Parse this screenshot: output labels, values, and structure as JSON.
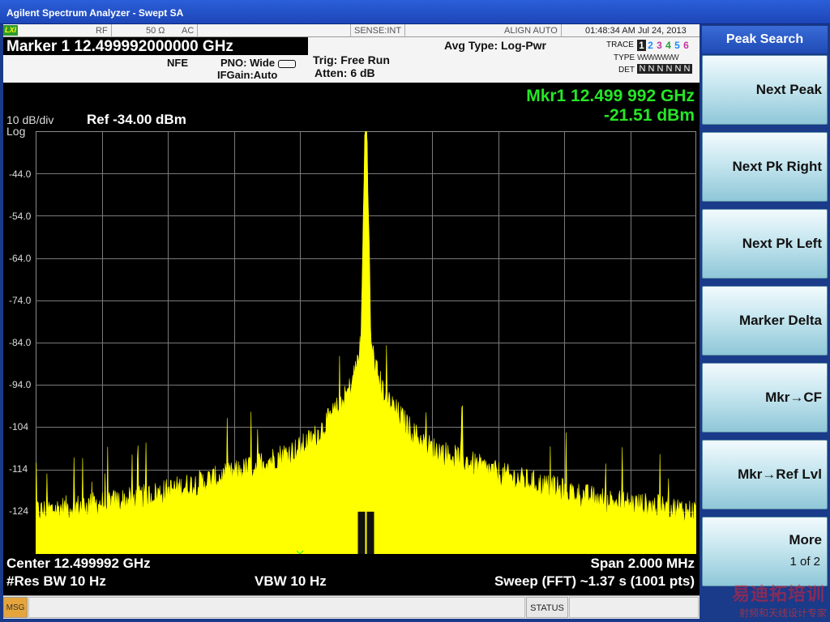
{
  "window": {
    "title": "Agilent Spectrum Analyzer - Swept SA"
  },
  "status": {
    "lxi": "LXI",
    "rf": "RF",
    "impedance": "50 Ω",
    "coupling": "AC",
    "sense": "SENSE:INT",
    "align": "ALIGN AUTO",
    "datetime": "01:48:34 AM Jul 24, 2013"
  },
  "marker": {
    "title": "Marker 1  12.499992000000 GHz",
    "freq_readout": "Mkr1 12.499 992 GHz",
    "amp_readout": "-21.51 dBm",
    "label": "1"
  },
  "settings": {
    "nfe": "NFE",
    "pno": "PNO: Wide",
    "ifgain": "IFGain:Auto",
    "trig": "Trig: Free Run",
    "atten": "Atten: 6 dB",
    "avg_type": "Avg Type: Log-Pwr"
  },
  "trace": {
    "trace_label": "TRACE",
    "type_label": "TYPE",
    "det_label": "DET",
    "numbers": [
      "1",
      "2",
      "3",
      "4",
      "5",
      "6"
    ],
    "number_colors": [
      "#222222",
      "#1a8cff",
      "#c0389e",
      "#1fa038",
      "#1a8cff",
      "#c0389e"
    ],
    "types": "WWWWWW",
    "dets": [
      "N",
      "N",
      "N",
      "N",
      "N",
      "N"
    ]
  },
  "display": {
    "scale": "10 dB/div",
    "scale_type": "Log",
    "ref": "Ref -34.00 dBm",
    "center": "Center 12.499992 GHz",
    "span": "Span 2.000 MHz",
    "rbw": "#Res BW 10 Hz",
    "vbw": "VBW 10 Hz",
    "sweep": "Sweep (FFT)  ~1.37 s (1001 pts)",
    "trace_color": "#ffff00",
    "marker_color": "#26e626"
  },
  "chart_data": {
    "type": "line",
    "ylim": [
      -134,
      -34
    ],
    "yticks": [
      "-44.0",
      "-54.0",
      "-64.0",
      "-74.0",
      "-84.0",
      "-94.0",
      "-104",
      "-114",
      "-124"
    ],
    "x_range_mhz": [
      -1.0,
      1.0
    ],
    "grid": true,
    "series": [
      {
        "points": [
          [
            -1.0,
            -126
          ],
          [
            -0.9,
            -125
          ],
          [
            -0.8,
            -124
          ],
          [
            -0.7,
            -123
          ],
          [
            -0.6,
            -121
          ],
          [
            -0.5,
            -119
          ],
          [
            -0.4,
            -117
          ],
          [
            -0.3,
            -114
          ],
          [
            -0.2,
            -111
          ],
          [
            -0.15,
            -108
          ],
          [
            -0.1,
            -103
          ],
          [
            -0.07,
            -100
          ],
          [
            -0.05,
            -97
          ],
          [
            -0.03,
            -92
          ],
          [
            -0.015,
            -86
          ],
          [
            0.0,
            -21.51
          ],
          [
            0.015,
            -86
          ],
          [
            0.03,
            -92
          ],
          [
            0.05,
            -97
          ],
          [
            0.07,
            -100
          ],
          [
            0.1,
            -103
          ],
          [
            0.15,
            -108
          ],
          [
            0.2,
            -111
          ],
          [
            0.3,
            -114
          ],
          [
            0.4,
            -117
          ],
          [
            0.5,
            -119
          ],
          [
            0.6,
            -121
          ],
          [
            0.7,
            -123
          ],
          [
            0.8,
            -124
          ],
          [
            0.9,
            -125
          ],
          [
            1.0,
            -126
          ]
        ]
      }
    ],
    "marker": {
      "x": 0.0,
      "y": -21.51
    }
  },
  "softkeys": {
    "menu_title": "Peak Search",
    "keys": [
      "Next Peak",
      "Next Pk Right",
      "Next Pk Left",
      "Marker Delta",
      "Mkr→CF",
      "Mkr→Ref Lvl"
    ],
    "more_label": "More",
    "more_sub": "1 of 2"
  },
  "statusbar": {
    "msg": "MSG",
    "status": "STATUS"
  },
  "watermark": {
    "main": "易迪拓培训",
    "sub": "射频和天线设计专家"
  }
}
